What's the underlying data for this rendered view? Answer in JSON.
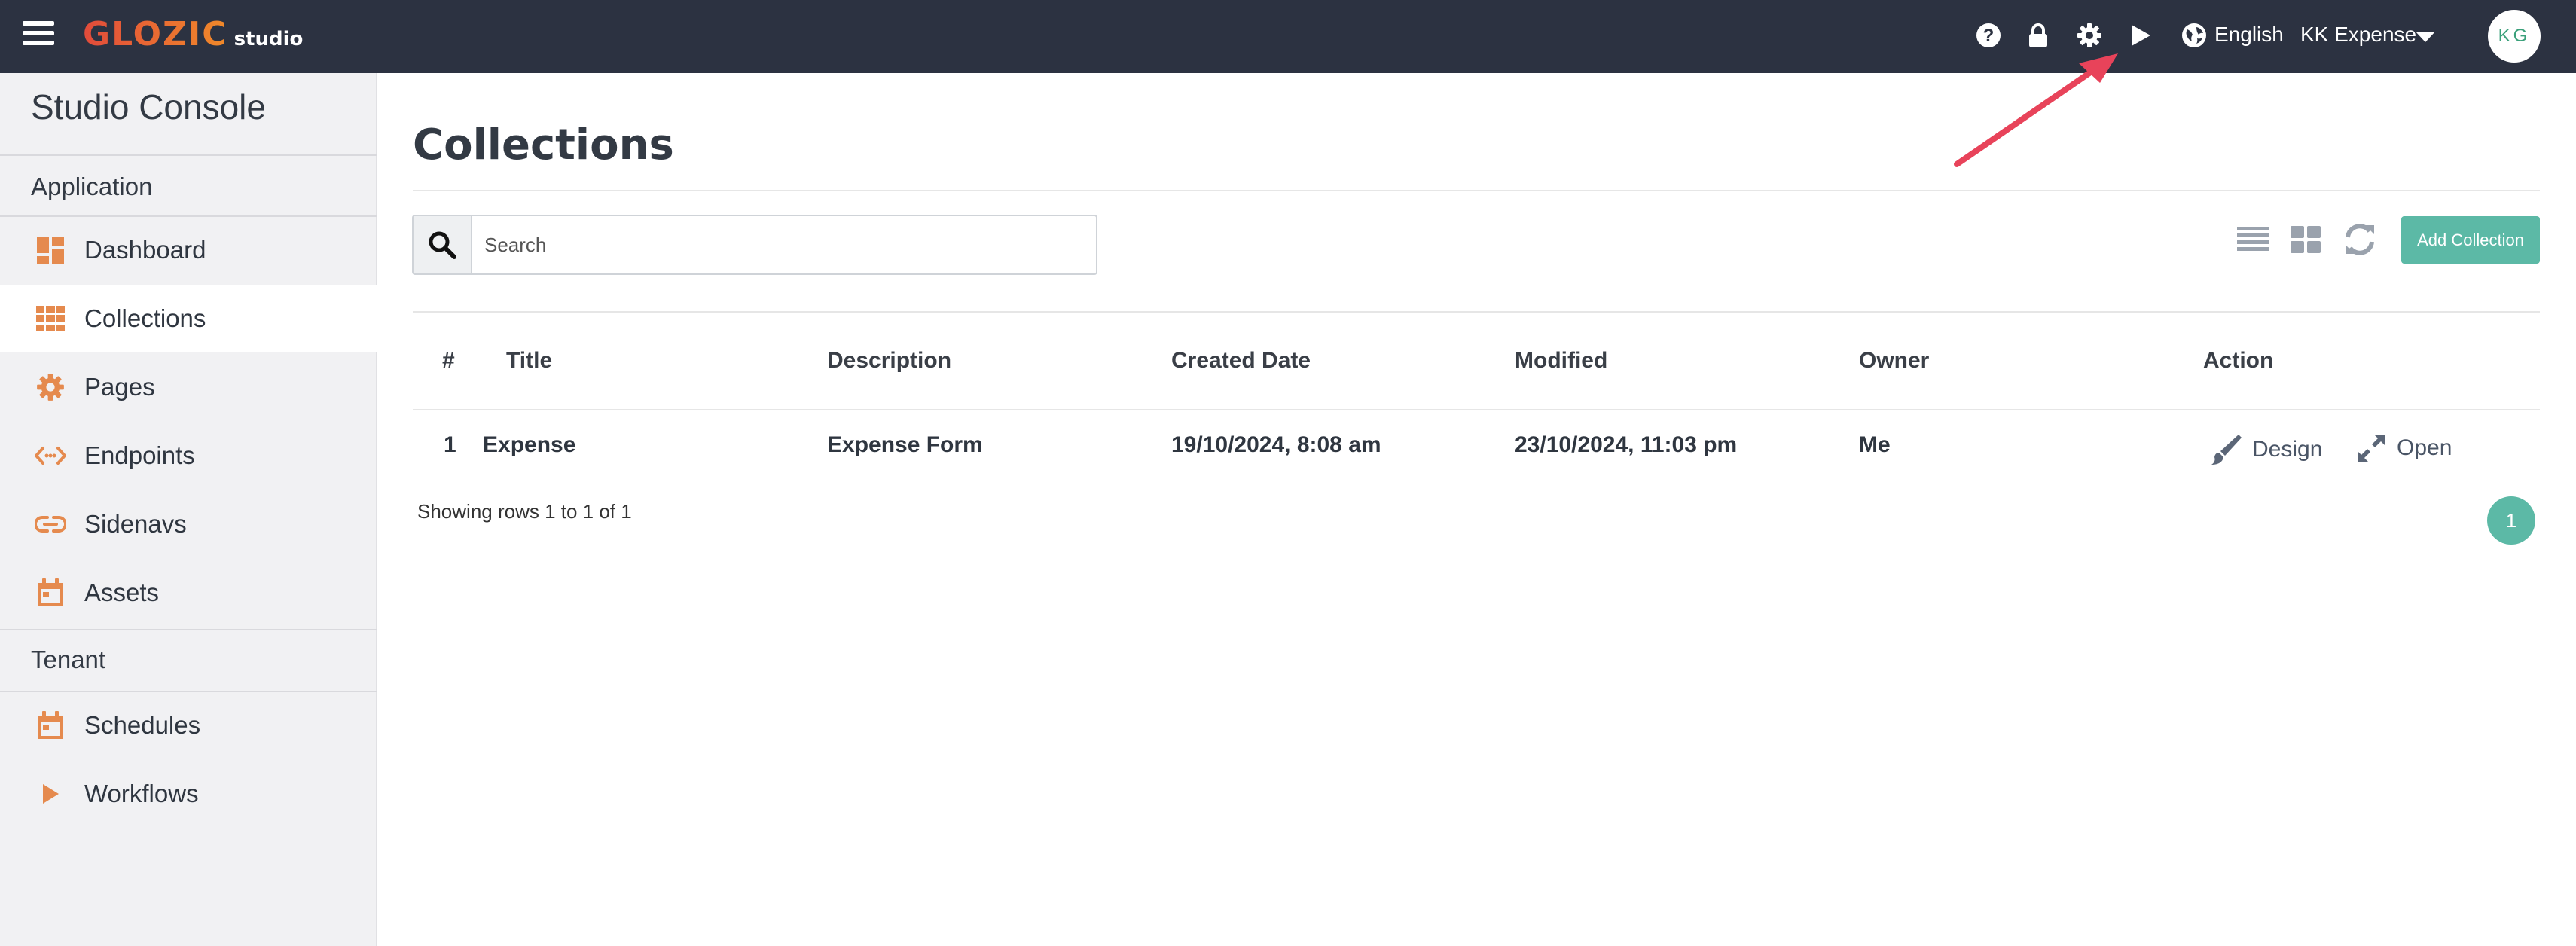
{
  "header": {
    "logo_main": "GLOZIC",
    "logo_sub": "studio",
    "language": "English",
    "tenant_select": "KK Expense",
    "avatar_initials": "KG",
    "icons": [
      "menu-icon",
      "help-icon",
      "lock-icon",
      "gear-icon",
      "play-icon",
      "globe-icon",
      "caret-down-icon"
    ]
  },
  "sidebar": {
    "title": "Studio Console",
    "sections": {
      "application": "Application",
      "tenant": "Tenant"
    },
    "items": [
      {
        "label": "Dashboard",
        "icon": "dashboard-icon"
      },
      {
        "label": "Collections",
        "icon": "collections-icon"
      },
      {
        "label": "Pages",
        "icon": "gear-icon"
      },
      {
        "label": "Endpoints",
        "icon": "code-icon"
      },
      {
        "label": "Sidenavs",
        "icon": "link-icon"
      },
      {
        "label": "Assets",
        "icon": "calendar-icon"
      },
      {
        "label": "Schedules",
        "icon": "calendar-icon"
      },
      {
        "label": "Workflows",
        "icon": "play-icon"
      }
    ],
    "active": "Collections"
  },
  "main": {
    "title": "Collections",
    "search": {
      "placeholder": "Search",
      "value": ""
    },
    "add_button": "Add Collection",
    "table": {
      "columns": [
        "#",
        "Title",
        "Description",
        "Created Date",
        "Modified",
        "Owner",
        "Action"
      ],
      "rows": [
        {
          "num": "1",
          "title": "Expense",
          "description": "Expense Form",
          "created": "19/10/2024, 8:08 am",
          "modified": "23/10/2024, 11:03 pm",
          "owner": "Me",
          "actions": [
            "Design",
            "Open"
          ]
        }
      ]
    },
    "rows_info": "Showing rows 1 to 1 of 1",
    "page": "1"
  },
  "colors": {
    "topbar": "#2c3241",
    "accent": "#5cb9a6",
    "sidebar_icon": "#e58a4e",
    "annotation_arrow": "#e8435a"
  }
}
